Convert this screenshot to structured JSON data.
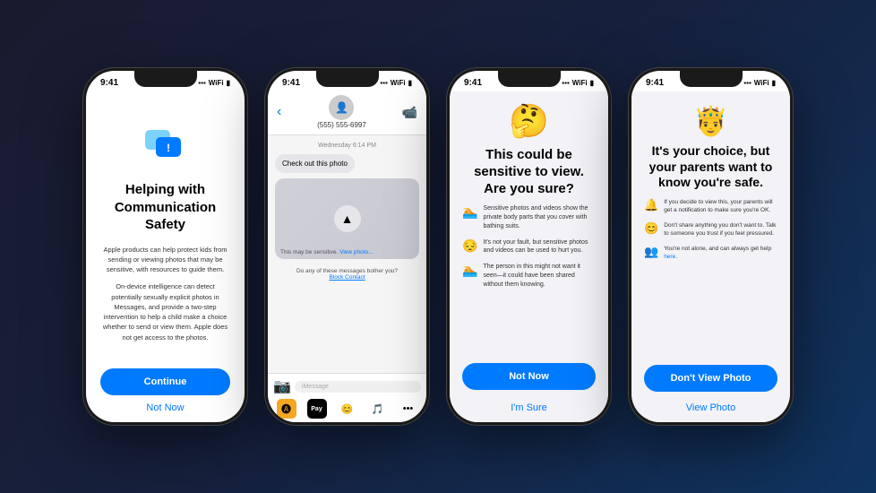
{
  "background": {
    "gradient": "dark blue"
  },
  "phones": [
    {
      "id": "phone1",
      "name": "communication-safety",
      "statusBar": {
        "time": "9:41",
        "icons": "signal wifi battery"
      },
      "icon": "💬",
      "title": "Helping with Communication Safety",
      "body1": "Apple products can help protect kids from sending or viewing photos that may be sensitive, with resources to guide them.",
      "body2": "On-device intelligence can detect potentially sexually explicit photos in Messages, and provide a two-step intervention to help a child make a choice whether to send or view them. Apple does not get access to the photos.",
      "continueButton": "Continue",
      "notNowText": "Not Now"
    },
    {
      "id": "phone2",
      "name": "messages-screen",
      "statusBar": {
        "time": "9:41",
        "icons": "signal wifi battery"
      },
      "contactPhone": "(555) 555-6997",
      "dateLabel": "Wednesday 6:14 PM",
      "messageText": "Check out this photo",
      "blurText": "This may be sensitive.",
      "viewPhotoLink": "View photo...",
      "botherText": "Do any of these messages bother you?",
      "blockLink": "Block Contact",
      "inputPlaceholder": "iMessage"
    },
    {
      "id": "phone3",
      "name": "warning-screen",
      "statusBar": {
        "time": "9:41",
        "icons": "signal wifi battery"
      },
      "emoji": "🤔",
      "title": "This could be sensitive to view. Are you sure?",
      "warningItems": [
        {
          "emoji": "🏊",
          "text": "Sensitive photos and videos show the private body parts that you cover with bathing suits."
        },
        {
          "emoji": "😔",
          "text": "It's not your fault, but sensitive photos and videos can be used to hurt you."
        },
        {
          "emoji": "🏊",
          "text": "The person in this might not want it seen—it could have been shared without them knowing."
        }
      ],
      "notNowButton": "Not Now",
      "imSureText": "I'm Sure"
    },
    {
      "id": "phone4",
      "name": "parents-screen",
      "statusBar": {
        "time": "9:41",
        "icons": "signal wifi battery"
      },
      "emoji": "🤴",
      "title": "It's your choice, but your parents want to know you're safe.",
      "infoItems": [
        {
          "emoji": "🔔",
          "text": "If you decide to view this, your parents will get a notification to make sure you're OK."
        },
        {
          "emoji": "😊",
          "text": "Don't share anything you don't want to. Talk to someone you trust if you feel pressured."
        },
        {
          "emoji": "👥",
          "text": "You're not alone, and can always get help here."
        }
      ],
      "dontViewButton": "Don't View Photo",
      "viewPhotoText": "View Photo"
    }
  ]
}
